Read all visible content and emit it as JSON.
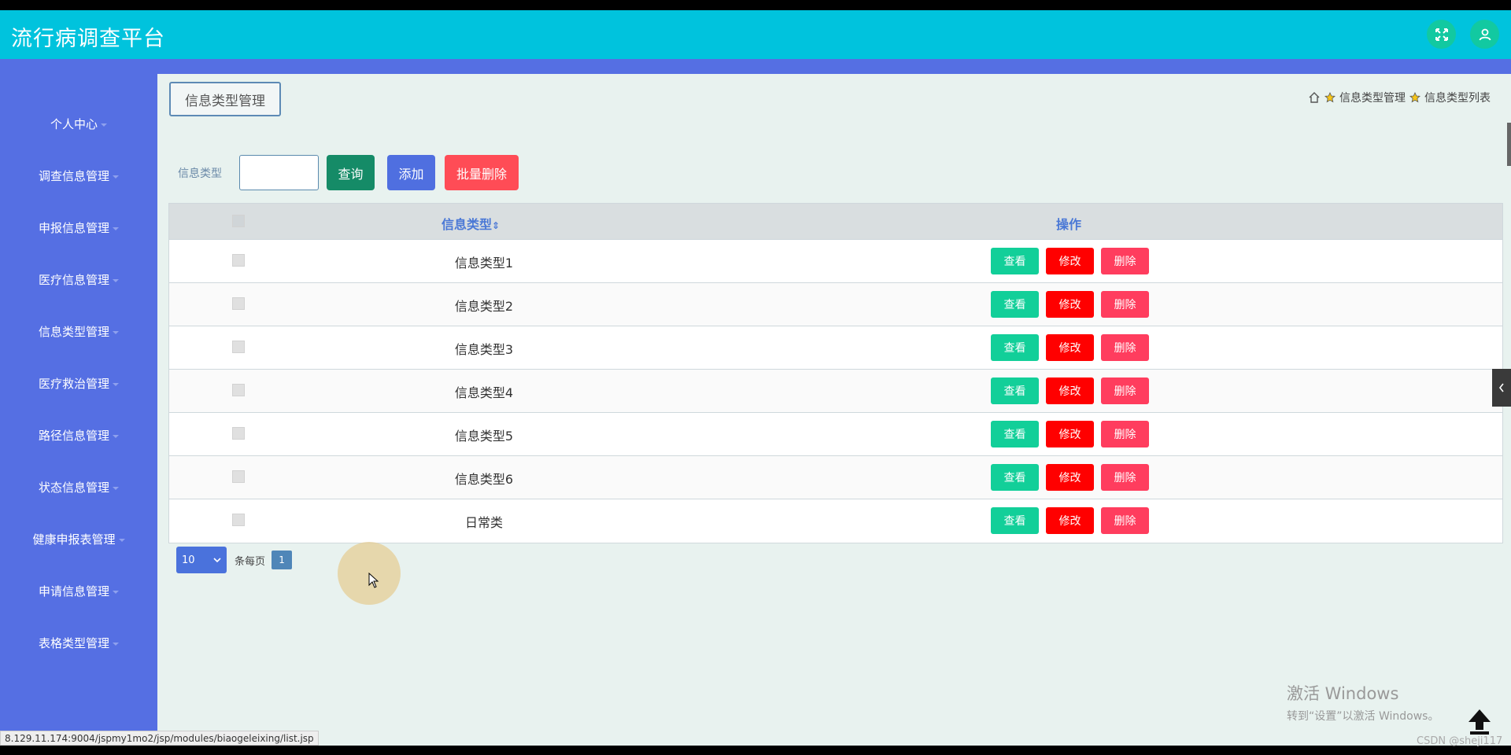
{
  "header": {
    "title": "流行病调查平台",
    "icons": [
      "fullscreen-icon",
      "user-icon"
    ]
  },
  "sidebar": {
    "items": [
      {
        "label": "个人中心"
      },
      {
        "label": "调查信息管理"
      },
      {
        "label": "申报信息管理"
      },
      {
        "label": "医疗信息管理"
      },
      {
        "label": "信息类型管理"
      },
      {
        "label": "医疗救治管理"
      },
      {
        "label": "路径信息管理"
      },
      {
        "label": "状态信息管理"
      },
      {
        "label": "健康申报表管理"
      },
      {
        "label": "申请信息管理"
      },
      {
        "label": "表格类型管理"
      }
    ]
  },
  "main": {
    "page_title": "信息类型管理",
    "breadcrumb": {
      "item1": "信息类型管理",
      "item2": "信息类型列表"
    },
    "search": {
      "label": "信息类型",
      "value": ""
    },
    "buttons": {
      "query": "查询",
      "add": "添加",
      "batch_delete": "批量删除"
    },
    "table": {
      "headers": {
        "type": "信息类型",
        "sort_indicator": "⇕",
        "ops": "操作"
      },
      "row_buttons": {
        "view": "查看",
        "edit": "修改",
        "delete": "删除"
      },
      "rows": [
        {
          "type": "信息类型1"
        },
        {
          "type": "信息类型2"
        },
        {
          "type": "信息类型3"
        },
        {
          "type": "信息类型4"
        },
        {
          "type": "信息类型5"
        },
        {
          "type": "信息类型6"
        },
        {
          "type": "日常类"
        }
      ]
    },
    "pager": {
      "page_size": "10",
      "per_page_label": "条每页",
      "page": "1"
    }
  },
  "overlays": {
    "watermark_title": "激活 Windows",
    "watermark_sub": "转到“设置”以激活 Windows。",
    "status_url": "8.129.11.174:9004/jspmy1mo2/jsp/modules/biaogeleixing/list.jsp",
    "csdn": "CSDN @sheji117"
  },
  "colors": {
    "header": "#00c3dd",
    "sidebar": "#556fe3",
    "query": "#158b67",
    "add": "#4f6fe0",
    "batch_delete": "#ff4c56",
    "view": "#12cf99",
    "edit": "#ff0000",
    "delete": "#ff3d5e"
  }
}
